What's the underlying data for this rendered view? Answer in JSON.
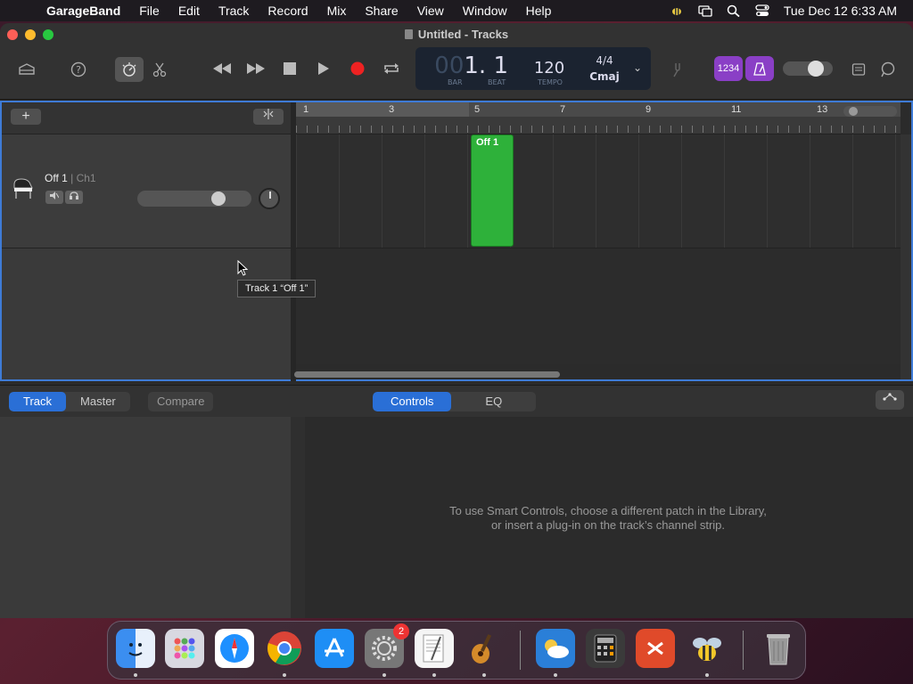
{
  "menubar": {
    "app": "GarageBand",
    "items": [
      "File",
      "Edit",
      "Track",
      "Record",
      "Mix",
      "Share",
      "View",
      "Window",
      "Help"
    ],
    "clock": "Tue Dec 12  6:33 AM"
  },
  "window": {
    "title": "Untitled - Tracks"
  },
  "lcd": {
    "position_dim": "00",
    "position": "1. 1",
    "bar_label": "BAR",
    "beat_label": "BEAT",
    "tempo": "120",
    "tempo_label": "TEMPO",
    "time_signature": "4/4",
    "key": "Cmaj"
  },
  "toolbar": {
    "count_in_label": "1234"
  },
  "tracks": {
    "add_label": "+",
    "track1": {
      "name": "Off 1",
      "channel": "| Ch1"
    },
    "region_name": "Off 1",
    "ruler_numbers": [
      "1",
      "3",
      "5",
      "7",
      "9",
      "11",
      "13"
    ]
  },
  "tooltip": "Track 1 “Off 1”",
  "smart_controls": {
    "tab_track": "Track",
    "tab_master": "Master",
    "compare": "Compare",
    "tab_controls": "Controls",
    "tab_eq": "EQ",
    "message_line1": "To use Smart Controls, choose a different patch in the Library,",
    "message_line2": "or insert a plug-in on the track’s channel strip."
  },
  "dock": {
    "items": [
      "Finder",
      "Launchpad",
      "Safari",
      "Chrome",
      "App Store",
      "System Preferences",
      "TextEdit",
      "GarageBand",
      "Weather",
      "Calculator",
      "Remote Desktop",
      "Bee",
      "Trash"
    ],
    "badge": "2"
  }
}
